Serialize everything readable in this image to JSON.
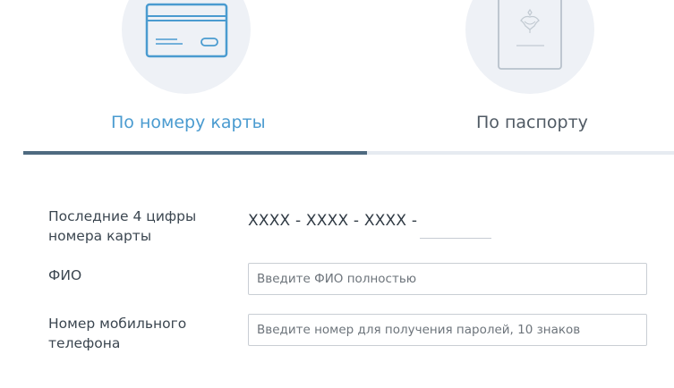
{
  "tabs": [
    {
      "label": "По номеру карты",
      "active": true,
      "icon": "credit-card-icon"
    },
    {
      "label": "По паспорту",
      "active": false,
      "icon": "passport-icon"
    }
  ],
  "form": {
    "card_digits": {
      "label": "Последние 4 цифры номера карты",
      "mask": "XXXX - XXXX - XXXX -",
      "value": ""
    },
    "fio": {
      "label": "ФИО",
      "placeholder": "Введите ФИО полностью",
      "value": ""
    },
    "phone": {
      "label": "Номер мобильного телефона",
      "placeholder": "Введите номер для получения паролей, 10 знаков",
      "value": ""
    }
  },
  "colors": {
    "active_tab_text": "#4a9bd0",
    "inactive_tab_text": "#505a64",
    "active_underline": "#4e6a80",
    "inactive_underline": "#e6ebf1",
    "icon_circle": "#eef1f6",
    "card_icon_stroke": "#4a9bd0",
    "passport_icon_stroke": "#b8c2cc"
  }
}
